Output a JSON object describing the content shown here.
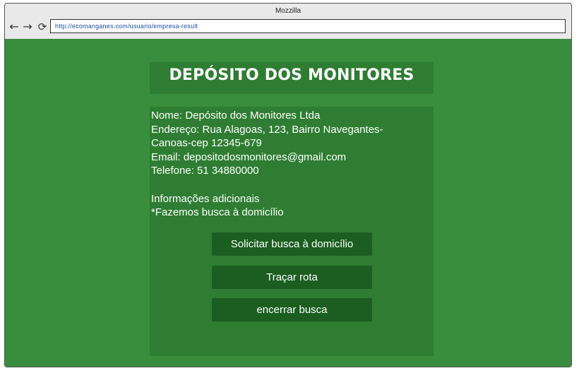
{
  "window": {
    "title": "Mozzilla"
  },
  "toolbar": {
    "back_icon": "←",
    "forward_icon": "→",
    "reload_icon": "⟳",
    "url": "http://ecomanganes.com/usuario/empresa-result"
  },
  "page": {
    "heading": "DEPÓSITO DOS MONITORES",
    "company": {
      "name_line": "Nome: Depósito dos Monitores Ltda",
      "address_line_1": "Endereço: Rua Alagoas, 123, Bairro Navegantes-",
      "address_line_2": "Canoas-cep 12345-679",
      "email_line": "Email: depositodosmonitores@gmail.com",
      "phone_line": "Telefone: 51 34880000",
      "extra_heading": "Informações adicionais",
      "extra_note": "*Fazemos busca à domicílio"
    },
    "actions": {
      "request_pickup": "Solicitar busca à domicílio",
      "trace_route": "Traçar rota",
      "end_search": "encerrar busca"
    }
  },
  "colors": {
    "page_background": "#388e3c",
    "panel_background": "#2e7d32",
    "button_background": "#1b5e20",
    "text": "#ffffff",
    "url_text": "#1a4fb0"
  }
}
